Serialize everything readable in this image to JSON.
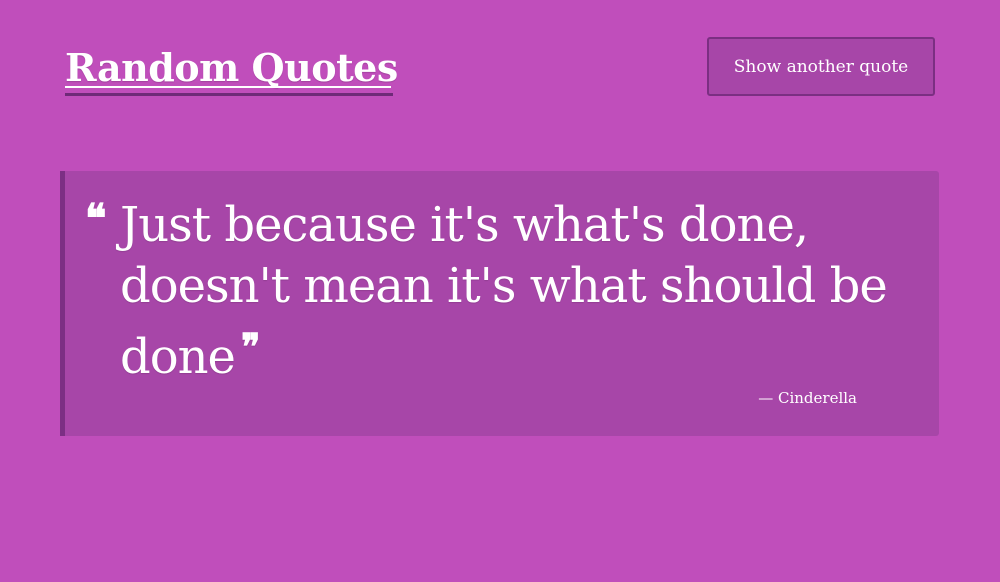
{
  "header": {
    "title": "Random Quotes",
    "new_quote_label": "Show another quote"
  },
  "quote": {
    "open_mark": "❝",
    "text": "Just because it's what's done, doesn't mean it's what should be done",
    "close_mark": "❞",
    "attribution": "— Cinderella"
  },
  "colors": {
    "background": "#c04ebb",
    "card": "#a746a8",
    "accent_border": "#7c2f84",
    "text": "#ffffff"
  }
}
